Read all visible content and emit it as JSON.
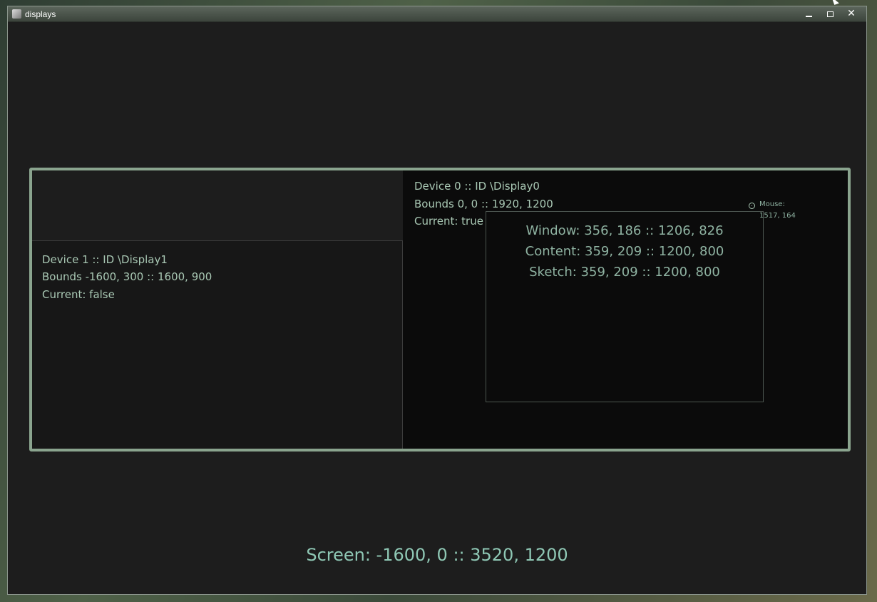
{
  "window": {
    "title": "displays",
    "minimize_label": "minimize",
    "maximize_label": "maximize",
    "close_label": "close",
    "icons": {
      "app": "app-icon",
      "minimize": "minimize-icon",
      "maximize": "maximize-icon",
      "close": "close-icon"
    }
  },
  "colors": {
    "frame": "#8aa48e",
    "text": "#a9c8b4",
    "summary_text": "#8fc8b5",
    "display_current_bg": "#0b0b0b",
    "display_other_bg": "#171717"
  },
  "displays": [
    {
      "device": "Device 1 :: ID \\Display1",
      "bounds": "Bounds -1600, 300 :: 1600, 900",
      "current": "Current: false"
    },
    {
      "device": "Device 0 :: ID \\Display0",
      "bounds": "Bounds 0, 0 :: 1920, 1200",
      "current": "Current: true"
    }
  ],
  "sketch_window": {
    "window": "Window: 356, 186 :: 1206, 826",
    "content": "Content: 359, 209 :: 1200, 800",
    "sketch": "Sketch: 359, 209 :: 1200, 800"
  },
  "mouse": {
    "label": "Mouse:",
    "position": "1517, 164",
    "icon": "mouse-marker-icon"
  },
  "screen": {
    "summary": "Screen: -1600, 0 :: 3520, 1200"
  }
}
